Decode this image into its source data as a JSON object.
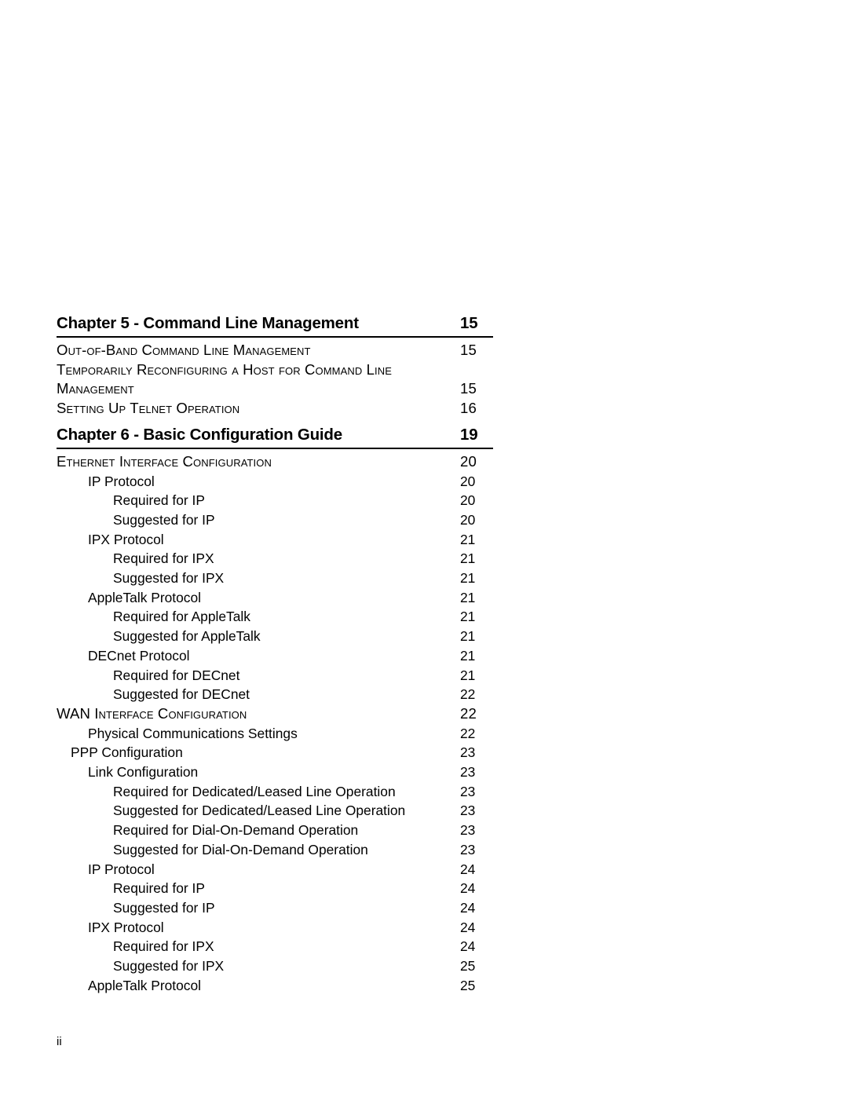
{
  "page": {
    "folio": "ii"
  },
  "chapters": [
    {
      "title": "Chapter 5 - Command Line Management",
      "page": "15",
      "entries": [
        {
          "label": "Out-of-Band Command Line Management",
          "page": "15",
          "level": 0,
          "style": "smallcaps"
        },
        {
          "label": "Temporarily Reconfiguring a Host for Command Line Management",
          "page": "15",
          "level": 0,
          "style": "smallcaps-wrap"
        },
        {
          "label": "Setting Up Telnet Operation",
          "page": "16",
          "level": 0,
          "style": "smallcaps"
        }
      ]
    },
    {
      "title": "Chapter 6 - Basic Configuration Guide",
      "page": "19",
      "entries": [
        {
          "label": "Ethernet Interface Configuration",
          "page": "20",
          "level": 0,
          "style": "smallcaps"
        },
        {
          "label": "IP Protocol",
          "page": "20",
          "level": 2,
          "style": "normal"
        },
        {
          "label": "Required for IP",
          "page": "20",
          "level": 3,
          "style": "normal"
        },
        {
          "label": "Suggested for IP",
          "page": "20",
          "level": 3,
          "style": "normal"
        },
        {
          "label": "IPX Protocol",
          "page": "21",
          "level": 2,
          "style": "normal"
        },
        {
          "label": "Required for IPX",
          "page": "21",
          "level": 3,
          "style": "normal"
        },
        {
          "label": "Suggested for IPX",
          "page": "21",
          "level": 3,
          "style": "normal"
        },
        {
          "label": "AppleTalk Protocol",
          "page": "21",
          "level": 2,
          "style": "normal"
        },
        {
          "label": "Required for AppleTalk",
          "page": "21",
          "level": 3,
          "style": "normal"
        },
        {
          "label": "Suggested for AppleTalk",
          "page": "21",
          "level": 3,
          "style": "normal"
        },
        {
          "label": "DECnet Protocol",
          "page": "21",
          "level": 2,
          "style": "normal"
        },
        {
          "label": "Required for DECnet",
          "page": "21",
          "level": 3,
          "style": "normal"
        },
        {
          "label": "Suggested for DECnet",
          "page": "22",
          "level": 3,
          "style": "normal"
        },
        {
          "label": "WAN Interface Configuration",
          "page": "22",
          "level": 0,
          "style": "smallcaps-acronym"
        },
        {
          "label": "Physical Communications Settings",
          "page": "22",
          "level": 2,
          "style": "normal"
        },
        {
          "label": "PPP Configuration",
          "page": "23",
          "level": 1,
          "style": "normal"
        },
        {
          "label": "Link Configuration",
          "page": "23",
          "level": 2,
          "style": "normal"
        },
        {
          "label": "Required for Dedicated/Leased Line Operation",
          "page": "23",
          "level": 3,
          "style": "normal"
        },
        {
          "label": "Suggested for Dedicated/Leased Line Operation",
          "page": "23",
          "level": 3,
          "style": "normal"
        },
        {
          "label": "Required for Dial-On-Demand Operation",
          "page": "23",
          "level": 3,
          "style": "normal"
        },
        {
          "label": "Suggested for Dial-On-Demand Operation",
          "page": "23",
          "level": 3,
          "style": "normal"
        },
        {
          "label": "IP Protocol",
          "page": "24",
          "level": 2,
          "style": "normal"
        },
        {
          "label": "Required for IP",
          "page": "24",
          "level": 3,
          "style": "normal"
        },
        {
          "label": "Suggested for IP",
          "page": "24",
          "level": 3,
          "style": "normal"
        },
        {
          "label": "IPX Protocol",
          "page": "24",
          "level": 2,
          "style": "normal"
        },
        {
          "label": "Required for IPX",
          "page": "24",
          "level": 3,
          "style": "normal"
        },
        {
          "label": "Suggested for IPX",
          "page": "25",
          "level": 3,
          "style": "normal"
        },
        {
          "label": "AppleTalk Protocol",
          "page": "25",
          "level": 2,
          "style": "normal"
        }
      ]
    }
  ]
}
